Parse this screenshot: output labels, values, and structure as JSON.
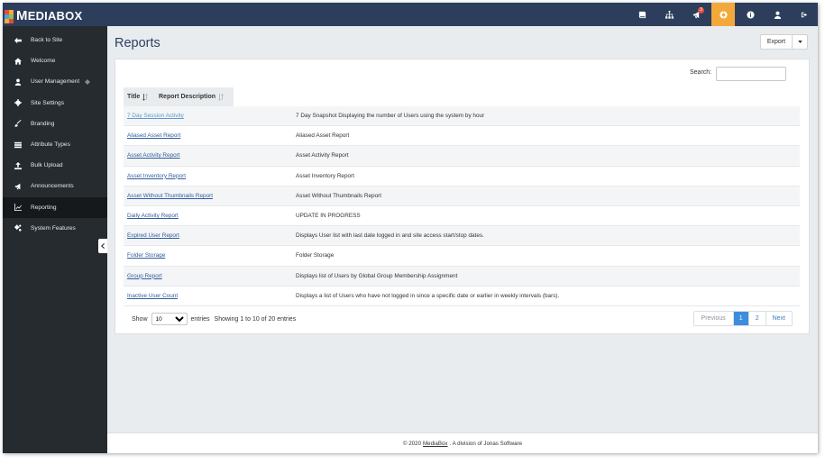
{
  "brand": {
    "name_first": "M",
    "name_rest": "EDIABOX",
    "logo_colors": [
      "#e94b35",
      "#f3a83b",
      "#4aa3df",
      "#8cc152"
    ]
  },
  "topbar": {
    "icons": [
      {
        "name": "book-icon",
        "active": false
      },
      {
        "name": "sitemap-icon",
        "active": false
      },
      {
        "name": "megaphone-icon",
        "active": false,
        "badge": "3"
      },
      {
        "name": "life-ring-icon",
        "active": true
      },
      {
        "name": "info-icon",
        "active": false
      },
      {
        "name": "user-icon",
        "active": false
      },
      {
        "name": "sign-out-icon",
        "active": false
      }
    ],
    "accent": "#f3a83b",
    "background": "#2d3e5c"
  },
  "sidebar": {
    "items": [
      {
        "label": "Back to Site",
        "icon": "arrow-left-icon"
      },
      {
        "label": "Welcome",
        "icon": "home-icon"
      },
      {
        "label": "User Management",
        "icon": "user-icon",
        "extra": "gear-icon"
      },
      {
        "label": "Site Settings",
        "icon": "cog-icon"
      },
      {
        "label": "Branding",
        "icon": "brush-icon"
      },
      {
        "label": "Attribute Types",
        "icon": "list-icon"
      },
      {
        "label": "Bulk Upload",
        "icon": "upload-icon"
      },
      {
        "label": "Announcements",
        "icon": "bullhorn-icon"
      },
      {
        "label": "Reporting",
        "icon": "chart-line-icon",
        "active": true
      },
      {
        "label": "System Features",
        "icon": "cogs-icon"
      }
    ]
  },
  "page": {
    "title": "Reports",
    "export_label": "Export"
  },
  "search": {
    "label": "Search:",
    "value": ""
  },
  "table": {
    "columns": [
      "Title",
      "Report Description"
    ],
    "rows": [
      {
        "title": "7 Day Session Activity",
        "description": "7 Day Snapshot Displaying the number of Users using the system by hour"
      },
      {
        "title": "Aliased Asset Report",
        "description": "Aliased Asset Report"
      },
      {
        "title": "Asset Activity Report",
        "description": "Asset Activity Report"
      },
      {
        "title": "Asset Inventory Report",
        "description": "Asset Inventory Report"
      },
      {
        "title": "Asset Without Thumbnails Report",
        "description": "Asset Without Thumbnails Report"
      },
      {
        "title": "Daily Activity Report",
        "description": "UPDATE IN PROGRESS"
      },
      {
        "title": "Expired User Report",
        "description": "Displays User list with last date logged in and site access start/stop dates."
      },
      {
        "title": "Folder Storage",
        "description": "Folder Storage"
      },
      {
        "title": "Group Report",
        "description": "Displays list of Users by Global Group Membership Assignment"
      },
      {
        "title": "Inactive User Count",
        "description": "Displays a list of Users who have not logged in since a specific date or earlier in weekly intervals (bars)."
      }
    ]
  },
  "length": {
    "show_label": "Show",
    "selected": "10",
    "entries_label": "entries"
  },
  "info": "Showing 1 to 10 of 20 entries",
  "pagination": {
    "previous": "Previous",
    "pages": [
      "1",
      "2"
    ],
    "current": "1",
    "next": "Next"
  },
  "footer": {
    "prefix": "© 2020",
    "link": "MediaBox",
    "suffix": ". A division of Jonas Software"
  }
}
